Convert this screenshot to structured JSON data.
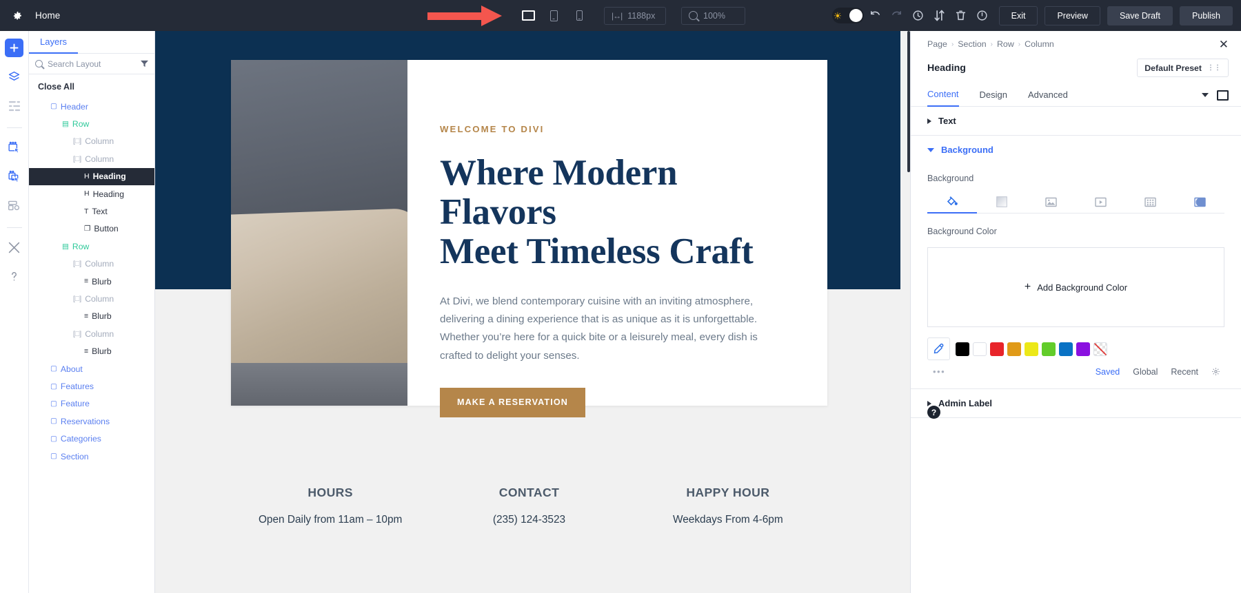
{
  "toolbar": {
    "gear_icon": "gear-icon",
    "page_title": "Home",
    "devices": [
      {
        "name": "desktop",
        "label": "Desktop",
        "active": true
      },
      {
        "name": "tablet",
        "label": "Tablet",
        "active": false
      },
      {
        "name": "phone",
        "label": "Phone",
        "active": false
      }
    ],
    "width_value": "1188px",
    "width_icon": "resize-horizontal-icon",
    "zoom_value": "100%",
    "zoom_icon": "magnifier-icon",
    "toggle": {
      "name": "light-dark-toggle",
      "icon": "sun-icon"
    },
    "icons": [
      {
        "name": "undo-icon",
        "glyph": "↶"
      },
      {
        "name": "redo-icon",
        "glyph": "↷"
      },
      {
        "name": "history-clock-icon",
        "glyph": "◴"
      },
      {
        "name": "sort-icon",
        "glyph": "⇅"
      },
      {
        "name": "trash-icon",
        "glyph": "Ὕ1"
      },
      {
        "name": "power-icon",
        "glyph": "⏻"
      }
    ],
    "buttons": [
      {
        "name": "exit-button",
        "label": "Exit",
        "style": "outline"
      },
      {
        "name": "preview-button",
        "label": "Preview",
        "style": "outline"
      },
      {
        "name": "save-draft-button",
        "label": "Save Draft",
        "style": "filled"
      },
      {
        "name": "publish-button",
        "label": "Publish",
        "style": "filled"
      }
    ],
    "annotation": {
      "name": "red-arrow-annotation",
      "color": "#f4564e"
    }
  },
  "rail": {
    "items": [
      {
        "name": "add-module-button",
        "icon": "plus-icon",
        "primary": true
      },
      {
        "name": "layers-button",
        "icon": "layers-icon"
      },
      {
        "name": "list-view-button",
        "icon": "list-icon"
      },
      {
        "name": "select-button",
        "icon": "select-cursor-icon"
      },
      {
        "name": "multiselect-button",
        "icon": "multiselect-cursor-icon"
      },
      {
        "name": "wireframe-button",
        "icon": "wireframe-icon"
      },
      {
        "name": "tools-button",
        "icon": "wrench-icon"
      },
      {
        "name": "help-button",
        "icon": "question-icon"
      }
    ]
  },
  "layers_panel": {
    "tab_label": "Layers",
    "search_placeholder": "Search Layout",
    "search_icon": "search-icon",
    "filter_icon": "funnel-icon",
    "close_all_label": "Close All",
    "tree": [
      {
        "label": "Header",
        "type": "section",
        "level": "sec",
        "icon": "section-icon",
        "selected": false
      },
      {
        "label": "Row",
        "type": "row",
        "level": "row",
        "icon": "row-icon",
        "selected": false
      },
      {
        "label": "Column",
        "type": "column",
        "level": "col",
        "icon": "column-icon",
        "selected": false
      },
      {
        "label": "Column",
        "type": "column",
        "level": "col",
        "icon": "column-icon",
        "selected": false
      },
      {
        "label": "Heading",
        "type": "module",
        "level": "mod",
        "icon": "heading-icon",
        "selected": true
      },
      {
        "label": "Heading",
        "type": "module",
        "level": "mod",
        "icon": "heading-icon",
        "selected": false
      },
      {
        "label": "Text",
        "type": "module",
        "level": "mod",
        "icon": "text-icon",
        "selected": false
      },
      {
        "label": "Button",
        "type": "module",
        "level": "mod",
        "icon": "button-icon",
        "selected": false
      },
      {
        "label": "Row",
        "type": "row",
        "level": "row",
        "icon": "row-icon",
        "selected": false
      },
      {
        "label": "Column",
        "type": "column",
        "level": "col",
        "icon": "column-icon",
        "selected": false
      },
      {
        "label": "Blurb",
        "type": "module",
        "level": "mod",
        "icon": "blurb-icon",
        "selected": false
      },
      {
        "label": "Column",
        "type": "column",
        "level": "col",
        "icon": "column-icon",
        "selected": false
      },
      {
        "label": "Blurb",
        "type": "module",
        "level": "mod",
        "icon": "blurb-icon",
        "selected": false
      },
      {
        "label": "Column",
        "type": "column",
        "level": "col",
        "icon": "column-icon",
        "selected": false
      },
      {
        "label": "Blurb",
        "type": "module",
        "level": "mod",
        "icon": "blurb-icon",
        "selected": false
      },
      {
        "label": "About",
        "type": "section",
        "level": "sec",
        "icon": "section-icon",
        "selected": false
      },
      {
        "label": "Features",
        "type": "section",
        "level": "sec",
        "icon": "section-icon",
        "selected": false
      },
      {
        "label": "Feature",
        "type": "section",
        "level": "sec",
        "icon": "section-icon",
        "selected": false
      },
      {
        "label": "Reservations",
        "type": "section",
        "level": "sec",
        "icon": "section-icon",
        "selected": false
      },
      {
        "label": "Categories",
        "type": "section",
        "level": "sec",
        "icon": "section-icon",
        "selected": false
      },
      {
        "label": "Section",
        "type": "section",
        "level": "sec",
        "icon": "section-icon",
        "selected": false
      }
    ]
  },
  "canvas": {
    "hero": {
      "eyebrow": "WELCOME TO DIVI",
      "heading_line1": "Where Modern Flavors",
      "heading_line2": "Meet Timeless Craft",
      "paragraph": "At Divi, we blend contemporary cuisine with an inviting atmosphere, delivering a dining experience that is as unique as it is unforgettable. Whether you’re here for a quick bite or a leisurely meal, every dish is crafted to delight your senses.",
      "cta_label": "MAKE A RESERVATION",
      "image_alt": "seeded breadsticks in a paper bag",
      "bg_color": "#0c3052",
      "accent_color": "#b5864a",
      "heading_color": "#14355c"
    },
    "footer": {
      "columns": [
        {
          "title": "HOURS",
          "value": "Open Daily from 11am – 10pm"
        },
        {
          "title": "CONTACT",
          "value": "(235) 124-3523"
        },
        {
          "title": "HAPPY HOUR",
          "value": "Weekdays From 4-6pm"
        }
      ]
    }
  },
  "right_panel": {
    "breadcrumb": [
      "Page",
      "Section",
      "Row",
      "Column"
    ],
    "close_icon": "close-icon",
    "module_title": "Heading",
    "preset_label": "Default Preset",
    "preset_icon": "preset-toggle-icon",
    "tabs": [
      {
        "name": "tab-content",
        "label": "Content",
        "active": true
      },
      {
        "name": "tab-design",
        "label": "Design",
        "active": false
      },
      {
        "name": "tab-advanced",
        "label": "Advanced",
        "active": false
      }
    ],
    "tab_caret_icon": "chevron-down-icon",
    "tab_square_icon": "expand-square-icon",
    "accordions": [
      {
        "name": "accordion-text",
        "label": "Text",
        "open": false
      },
      {
        "name": "accordion-background",
        "label": "Background",
        "open": true
      },
      {
        "name": "accordion-admin-label",
        "label": "Admin Label",
        "open": false
      }
    ],
    "background": {
      "field_label": "Background",
      "type_tabs": [
        {
          "name": "bg-color-tab",
          "icon": "paint-bucket-icon",
          "active": true
        },
        {
          "name": "bg-gradient-tab",
          "icon": "gradient-icon",
          "active": false
        },
        {
          "name": "bg-image-tab",
          "icon": "image-icon",
          "active": false
        },
        {
          "name": "bg-video-tab",
          "icon": "video-icon",
          "active": false
        },
        {
          "name": "bg-pattern-tab",
          "icon": "pattern-icon",
          "active": false
        },
        {
          "name": "bg-mask-tab",
          "icon": "mask-icon",
          "active": false
        }
      ],
      "color_label": "Background Color",
      "add_color_label": "Add Background Color",
      "eyedropper_icon": "eyedropper-icon",
      "swatches": [
        {
          "name": "swatch-black",
          "color": "#000000"
        },
        {
          "name": "swatch-white",
          "color": "#ffffff"
        },
        {
          "name": "swatch-red",
          "color": "#e8242a"
        },
        {
          "name": "swatch-orange",
          "color": "#e09a18"
        },
        {
          "name": "swatch-yellow",
          "color": "#ece818"
        },
        {
          "name": "swatch-green",
          "color": "#62cc2a"
        },
        {
          "name": "swatch-blue",
          "color": "#0a72c4"
        },
        {
          "name": "swatch-purple",
          "color": "#8a10e0"
        },
        {
          "name": "swatch-transparent",
          "color": "transparent"
        }
      ],
      "more_icon": "more-dots-icon",
      "palette_links": [
        {
          "name": "palette-saved",
          "label": "Saved",
          "active": true
        },
        {
          "name": "palette-global",
          "label": "Global",
          "active": false
        },
        {
          "name": "palette-recent",
          "label": "Recent",
          "active": false
        }
      ],
      "settings_icon": "gear-icon"
    },
    "help_icon": "question-mark-icon"
  }
}
